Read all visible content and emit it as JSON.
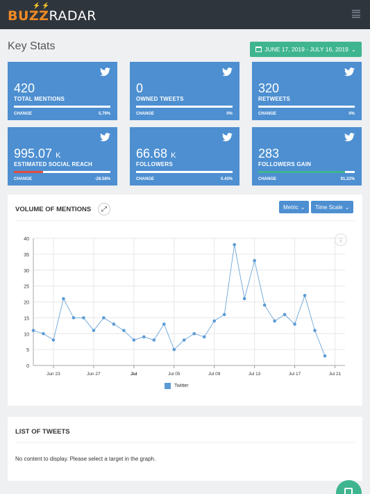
{
  "app": {
    "logo_left": "BUZZ",
    "logo_right": "RADAR",
    "logo_bolts": "⚡⚡"
  },
  "page": {
    "title": "Key Stats",
    "date_range": "JUNE 17, 2019 - JULY 16, 2019"
  },
  "cards": [
    {
      "value": "420",
      "unit": "",
      "label": "TOTAL MENTIONS",
      "change_label": "CHANGE",
      "change": "5.79%",
      "bar_fill": 0,
      "bar_color": "#ffffff"
    },
    {
      "value": "0",
      "unit": "",
      "label": "OWNED TWEETS",
      "change_label": "CHANGE",
      "change": "0%",
      "bar_fill": 0,
      "bar_color": "#ffffff"
    },
    {
      "value": "320",
      "unit": "",
      "label": "RETWEETS",
      "change_label": "CHANGE",
      "change": "0%",
      "bar_fill": 0,
      "bar_color": "#ffffff"
    },
    {
      "value": "995.07",
      "unit": "K",
      "label": "ESTIMATED SOCIAL REACH",
      "change_label": "CHANGE",
      "change": "-28.58%",
      "bar_fill": 0.3,
      "bar_color": "#e74c3c"
    },
    {
      "value": "66.68",
      "unit": "K",
      "label": "FOLLOWERS",
      "change_label": "CHANGE",
      "change": "0.43%",
      "bar_fill": 0,
      "bar_color": "#ffffff"
    },
    {
      "value": "283",
      "unit": "",
      "label": "FOLLOWERS GAIN",
      "change_label": "CHANGE",
      "change": "91.22%",
      "bar_fill": 0.9,
      "bar_color": "#3fb58f"
    }
  ],
  "volume": {
    "title": "VOLUME OF MENTIONS",
    "metric_label": "Metric",
    "timescale_label": "Time Scale"
  },
  "chart_data": {
    "type": "line",
    "title": "",
    "xlabel": "",
    "ylabel": "",
    "ylim": [
      0,
      40
    ],
    "yticks": [
      0,
      5,
      10,
      15,
      20,
      25,
      30,
      35,
      40
    ],
    "x": [
      "2019-06-21",
      "2019-06-22",
      "2019-06-23",
      "2019-06-24",
      "2019-06-25",
      "2019-06-26",
      "2019-06-27",
      "2019-06-28",
      "2019-06-29",
      "2019-06-30",
      "2019-07-01",
      "2019-07-02",
      "2019-07-03",
      "2019-07-04",
      "2019-07-05",
      "2019-07-06",
      "2019-07-07",
      "2019-07-08",
      "2019-07-09",
      "2019-07-10",
      "2019-07-11",
      "2019-07-12",
      "2019-07-13",
      "2019-07-14",
      "2019-07-15",
      "2019-07-16",
      "2019-07-17",
      "2019-07-18",
      "2019-07-19",
      "2019-07-20",
      "2019-07-21",
      "2019-07-22"
    ],
    "xticks": [
      {
        "date": "2019-06-23",
        "label": "Jun 23",
        "bold": false
      },
      {
        "date": "2019-06-27",
        "label": "Jun 27",
        "bold": false
      },
      {
        "date": "2019-07-01",
        "label": "Jul",
        "bold": true
      },
      {
        "date": "2019-07-05",
        "label": "Jul 05",
        "bold": false
      },
      {
        "date": "2019-07-09",
        "label": "Jul 09",
        "bold": false
      },
      {
        "date": "2019-07-13",
        "label": "Jul 13",
        "bold": false
      },
      {
        "date": "2019-07-17",
        "label": "Jul 17",
        "bold": false
      },
      {
        "date": "2019-07-21",
        "label": "Jul 21",
        "bold": false
      }
    ],
    "series": [
      {
        "name": "Twitter",
        "color": "#5b9bd5",
        "values": [
          11,
          10,
          8,
          21,
          15,
          15,
          11,
          15,
          13,
          11,
          8,
          9,
          8,
          13,
          5,
          8,
          10,
          9,
          14,
          16,
          38,
          21,
          33,
          19,
          14,
          16,
          13,
          22,
          11,
          3
        ]
      }
    ],
    "grid": true,
    "legend": "bottom-center"
  },
  "tweets": {
    "title": "LIST OF TWEETS",
    "empty_message": "No content to display. Please select a target in the graph."
  }
}
